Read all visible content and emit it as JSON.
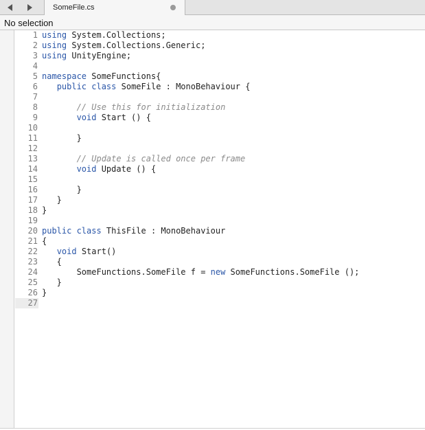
{
  "tab": {
    "title": "SomeFile.cs"
  },
  "jumpbar": {
    "label": "No selection"
  },
  "icons": {
    "back": "back-arrow-icon",
    "forward": "forward-arrow-icon",
    "unsaved": "dot-icon"
  },
  "colors": {
    "keyword": "#2a56a8",
    "comment": "#8a8a8a",
    "text": "#222222"
  },
  "current_line": 27,
  "lines": [
    {
      "n": "1",
      "t": [
        [
          "kw",
          "using"
        ],
        [
          "",
          "  System.Collections;"
        ]
      ]
    },
    {
      "n": "2",
      "t": [
        [
          "kw",
          "using"
        ],
        [
          "",
          "  System.Collections.Generic;"
        ]
      ]
    },
    {
      "n": "3",
      "t": [
        [
          "kw",
          "using"
        ],
        [
          "",
          "  UnityEngine;"
        ]
      ]
    },
    {
      "n": "4",
      "t": []
    },
    {
      "n": "5",
      "t": [
        [
          "kw",
          "namespace"
        ],
        [
          "",
          "  SomeFunctions{"
        ]
      ]
    },
    {
      "n": "6",
      "t": [
        [
          "",
          "    "
        ],
        [
          "kw",
          "public class"
        ],
        [
          "",
          "  SomeFile : MonoBehaviour {"
        ]
      ]
    },
    {
      "n": "7",
      "t": []
    },
    {
      "n": "8",
      "t": [
        [
          "",
          "        "
        ],
        [
          "cm",
          "// Use this for initialization"
        ]
      ]
    },
    {
      "n": "9",
      "t": [
        [
          "",
          "        "
        ],
        [
          "kw",
          "void"
        ],
        [
          "",
          "  Start () {"
        ]
      ]
    },
    {
      "n": "10",
      "t": []
    },
    {
      "n": "11",
      "t": [
        [
          "",
          "        }"
        ]
      ]
    },
    {
      "n": "12",
      "t": []
    },
    {
      "n": "13",
      "t": [
        [
          "",
          "        "
        ],
        [
          "cm",
          "// Update is called once per frame"
        ]
      ]
    },
    {
      "n": "14",
      "t": [
        [
          "",
          "        "
        ],
        [
          "kw",
          "void"
        ],
        [
          "",
          "  Update () {"
        ]
      ]
    },
    {
      "n": "15",
      "t": []
    },
    {
      "n": "16",
      "t": [
        [
          "",
          "        }"
        ]
      ]
    },
    {
      "n": "17",
      "t": [
        [
          "",
          "    }"
        ]
      ]
    },
    {
      "n": "18",
      "t": [
        [
          "",
          "}"
        ]
      ]
    },
    {
      "n": "19",
      "t": []
    },
    {
      "n": "20",
      "t": [
        [
          "kw",
          "public class"
        ],
        [
          "",
          "  ThisFile : MonoBehaviour"
        ]
      ]
    },
    {
      "n": "21",
      "t": [
        [
          "",
          "{"
        ]
      ]
    },
    {
      "n": "22",
      "t": [
        [
          "",
          "    "
        ],
        [
          "kw",
          "void"
        ],
        [
          "",
          "  Start()"
        ]
      ]
    },
    {
      "n": "23",
      "t": [
        [
          "",
          "    {"
        ]
      ]
    },
    {
      "n": "24",
      "t": [
        [
          "",
          "        SomeFunctions.SomeFile f = "
        ],
        [
          "kw",
          "new"
        ],
        [
          "",
          "  SomeFunctions.SomeFile ();"
        ]
      ]
    },
    {
      "n": "25",
      "t": [
        [
          "",
          "    }"
        ]
      ]
    },
    {
      "n": "26",
      "t": [
        [
          "",
          "}"
        ]
      ]
    },
    {
      "n": "27",
      "t": []
    }
  ]
}
